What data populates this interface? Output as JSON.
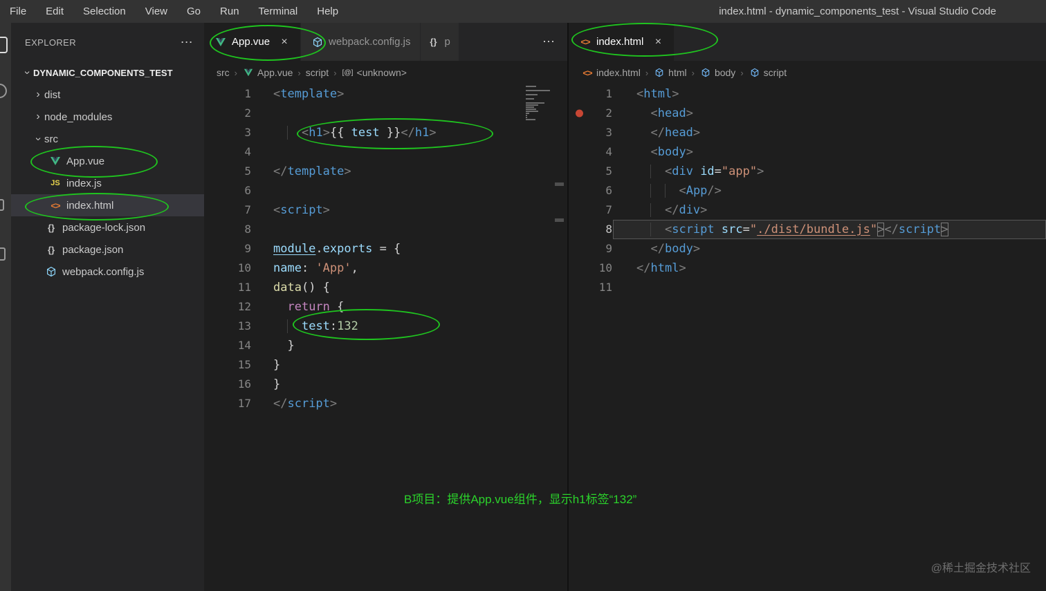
{
  "window": {
    "title": "index.html - dynamic_components_test - Visual Studio Code"
  },
  "menu": {
    "items": [
      "File",
      "Edit",
      "Selection",
      "View",
      "Go",
      "Run",
      "Terminal",
      "Help"
    ]
  },
  "ui": {
    "chevron": "›",
    "crumb_sep": "›",
    "more": "⋯",
    "close": "×"
  },
  "colors": {
    "annotation_green": "#2bd32b",
    "ellipse_green": "#1fc41f",
    "breakpoint_red": "#c74634",
    "selection_row": "#37373d",
    "editor_bg": "#1e1e1e",
    "sidebar_bg": "#252526",
    "titlebar_bg": "#333333"
  },
  "explorer": {
    "header": "EXPLORER",
    "more": "⋯",
    "root": "DYNAMIC_COMPONENTS_TEST",
    "items": [
      {
        "label": "dist",
        "type": "folder",
        "indent": 0
      },
      {
        "label": "node_modules",
        "type": "folder",
        "indent": 0
      },
      {
        "label": "src",
        "type": "folder",
        "indent": 0,
        "expanded": true
      },
      {
        "label": "App.vue",
        "icon": "vue",
        "indent": 1
      },
      {
        "label": "index.js",
        "icon": "js",
        "indent": 1
      },
      {
        "label": "index.html",
        "icon": "html",
        "indent": 1,
        "selected": true
      },
      {
        "label": "package-lock.json",
        "icon": "json",
        "indent": 0
      },
      {
        "label": "package.json",
        "icon": "json",
        "indent": 0
      },
      {
        "label": "webpack.config.js",
        "icon": "webpack",
        "indent": 0
      }
    ]
  },
  "group1": {
    "more": "⋯",
    "tabs": [
      {
        "label": "App.vue",
        "icon": "vue",
        "active": true,
        "close": "×"
      },
      {
        "label": "webpack.config.js",
        "icon": "webpack"
      },
      {
        "label": "p",
        "icon": "json",
        "partial": true
      }
    ],
    "breadcrumb": [
      {
        "label": "src"
      },
      {
        "label": "App.vue",
        "icon": "vue"
      },
      {
        "label": "script"
      },
      {
        "label": "<unknown>",
        "icon": "symbol"
      }
    ],
    "lines": [
      {
        "n": 1,
        "seg": [
          [
            "pb",
            "<"
          ],
          [
            "tag",
            "template"
          ],
          [
            "pb",
            ">"
          ]
        ]
      },
      {
        "n": 2,
        "seg": []
      },
      {
        "n": 3,
        "seg": [
          [
            "pl",
            "  "
          ],
          [
            "ws",
            "  "
          ],
          [
            "pb",
            "<"
          ],
          [
            "tag",
            "h1"
          ],
          [
            "pb",
            ">"
          ],
          [
            "pl",
            "{{ "
          ],
          [
            "var",
            "test"
          ],
          [
            "pl",
            " }}"
          ],
          [
            "pb",
            "</"
          ],
          [
            "tag",
            "h1"
          ],
          [
            "pb",
            ">"
          ]
        ]
      },
      {
        "n": 4,
        "seg": []
      },
      {
        "n": 5,
        "seg": [
          [
            "pb",
            "</"
          ],
          [
            "tag",
            "template"
          ],
          [
            "pb",
            ">"
          ]
        ]
      },
      {
        "n": 6,
        "seg": []
      },
      {
        "n": 7,
        "seg": [
          [
            "pb",
            "<"
          ],
          [
            "tag",
            "script"
          ],
          [
            "pb",
            ">"
          ]
        ]
      },
      {
        "n": 8,
        "seg": []
      },
      {
        "n": 9,
        "seg": [
          [
            "varu",
            "module"
          ],
          [
            "pl",
            "."
          ],
          [
            "var",
            "exports"
          ],
          [
            "pl",
            " = {"
          ]
        ]
      },
      {
        "n": 10,
        "seg": [
          [
            "var",
            "name"
          ],
          [
            "pl",
            ": "
          ],
          [
            "str",
            "'App'"
          ],
          [
            "pl",
            ","
          ]
        ]
      },
      {
        "n": 11,
        "seg": [
          [
            "fn",
            "data"
          ],
          [
            "pl",
            "() {"
          ]
        ]
      },
      {
        "n": 12,
        "seg": [
          [
            "pl",
            "  "
          ],
          [
            "kw",
            "return"
          ],
          [
            "pl",
            " {"
          ]
        ]
      },
      {
        "n": 13,
        "seg": [
          [
            "pl",
            "  "
          ],
          [
            "ws",
            "  "
          ],
          [
            "var",
            "test"
          ],
          [
            "pl",
            ":"
          ],
          [
            "num",
            "132"
          ]
        ]
      },
      {
        "n": 14,
        "seg": [
          [
            "pl",
            "  }"
          ]
        ]
      },
      {
        "n": 15,
        "seg": [
          [
            "pl",
            "}"
          ]
        ]
      },
      {
        "n": 16,
        "seg": [
          [
            "pl",
            "}"
          ]
        ]
      },
      {
        "n": 17,
        "seg": [
          [
            "pb",
            "</"
          ],
          [
            "tag",
            "script"
          ],
          [
            "pb",
            ">"
          ]
        ]
      }
    ]
  },
  "group2": {
    "tabs": [
      {
        "label": "index.html",
        "icon": "html",
        "active": true,
        "close": "×"
      }
    ],
    "breadcrumb": [
      {
        "label": "index.html",
        "icon": "html"
      },
      {
        "label": "html",
        "icon": "cube"
      },
      {
        "label": "body",
        "icon": "cube"
      },
      {
        "label": "script",
        "icon": "cube"
      }
    ],
    "lines": [
      {
        "n": 1,
        "seg": [
          [
            "pb",
            "<"
          ],
          [
            "tag",
            "html"
          ],
          [
            "pb",
            ">"
          ]
        ]
      },
      {
        "n": 2,
        "breakpoint": true,
        "seg": [
          [
            "pl",
            "  "
          ],
          [
            "pb",
            "<"
          ],
          [
            "tag",
            "head"
          ],
          [
            "pb",
            ">"
          ]
        ]
      },
      {
        "n": 3,
        "seg": [
          [
            "pl",
            "  "
          ],
          [
            "pb",
            "</"
          ],
          [
            "tag",
            "head"
          ],
          [
            "pb",
            ">"
          ]
        ]
      },
      {
        "n": 4,
        "seg": [
          [
            "pl",
            "  "
          ],
          [
            "pb",
            "<"
          ],
          [
            "tag",
            "body"
          ],
          [
            "pb",
            ">"
          ]
        ]
      },
      {
        "n": 5,
        "seg": [
          [
            "pl",
            "  "
          ],
          [
            "ws",
            "  "
          ],
          [
            "pb",
            "<"
          ],
          [
            "tag",
            "div"
          ],
          [
            "pl",
            " "
          ],
          [
            "attr",
            "id"
          ],
          [
            "pl",
            "="
          ],
          [
            "str",
            "\"app\""
          ],
          [
            "pb",
            ">"
          ]
        ]
      },
      {
        "n": 6,
        "seg": [
          [
            "pl",
            "  "
          ],
          [
            "ws",
            "  "
          ],
          [
            "ws",
            "  "
          ],
          [
            "pb",
            "<"
          ],
          [
            "tag",
            "App"
          ],
          [
            "pb",
            "/>"
          ]
        ]
      },
      {
        "n": 7,
        "seg": [
          [
            "pl",
            "  "
          ],
          [
            "ws",
            "  "
          ],
          [
            "pb",
            "</"
          ],
          [
            "tag",
            "div"
          ],
          [
            "pb",
            ">"
          ]
        ]
      },
      {
        "n": 8,
        "current": true,
        "seg": [
          [
            "pl",
            "  "
          ],
          [
            "ws",
            "  "
          ],
          [
            "pb",
            "<"
          ],
          [
            "tag",
            "script"
          ],
          [
            "pl",
            " "
          ],
          [
            "attr",
            "src"
          ],
          [
            "pl",
            "="
          ],
          [
            "str",
            "\""
          ],
          [
            "link",
            "./dist/bundle.js"
          ],
          [
            "str",
            "\""
          ],
          [
            "pbx",
            ">"
          ],
          [
            "pb",
            "</"
          ],
          [
            "tag",
            "script"
          ],
          [
            "pbx",
            ">"
          ]
        ]
      },
      {
        "n": 9,
        "seg": [
          [
            "pl",
            "  "
          ],
          [
            "pb",
            "</"
          ],
          [
            "tag",
            "body"
          ],
          [
            "pb",
            ">"
          ]
        ]
      },
      {
        "n": 10,
        "seg": [
          [
            "pb",
            "</"
          ],
          [
            "tag",
            "html"
          ],
          [
            "pb",
            ">"
          ]
        ]
      },
      {
        "n": 11,
        "seg": []
      }
    ]
  },
  "annotation": {
    "text": "B项目：提供App.vue组件，显示h1标签“132”"
  },
  "watermark": "@稀土掘金技术社区"
}
